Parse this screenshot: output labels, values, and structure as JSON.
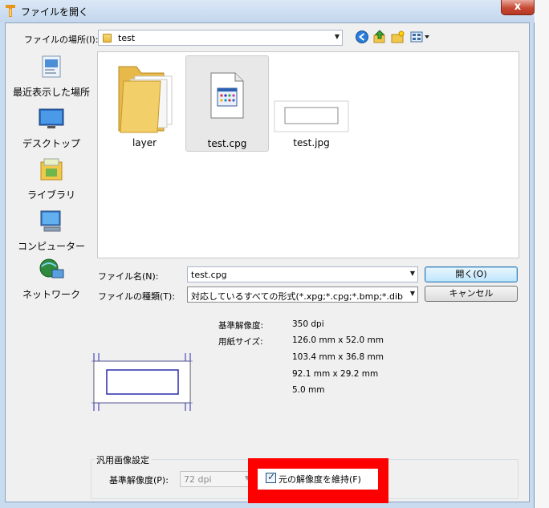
{
  "window": {
    "title": "ファイルを開く",
    "close_label": "x"
  },
  "location": {
    "label": "ファイルの場所(I):",
    "value": "test"
  },
  "places": [
    {
      "label": "最近表示した場所",
      "icon": "recent-places-icon"
    },
    {
      "label": "デスクトップ",
      "icon": "desktop-icon"
    },
    {
      "label": "ライブラリ",
      "icon": "libraries-icon"
    },
    {
      "label": "コンピューター",
      "icon": "computer-icon"
    },
    {
      "label": "ネットワーク",
      "icon": "network-icon"
    }
  ],
  "files": [
    {
      "name": "layer",
      "type": "folder"
    },
    {
      "name": "test.cpg",
      "type": "cpg",
      "selected": true
    },
    {
      "name": "test.jpg",
      "type": "jpg"
    }
  ],
  "filename": {
    "label": "ファイル名(N):",
    "value": "test.cpg"
  },
  "filetype": {
    "label": "ファイルの種類(T):",
    "value": "対応しているすべての形式(*.xpg;*.cpg;*.bmp;*.dib;*.jpg"
  },
  "buttons": {
    "open": "開く(O)",
    "cancel": "キャンセル"
  },
  "info": {
    "resolution_label": "基準解像度:",
    "resolution_value": "350 dpi",
    "paper_label": "用紙サイズ:",
    "paper_values": [
      "126.0 mm x 52.0 mm",
      "103.4 mm x 36.8 mm",
      "92.1 mm x 29.2 mm",
      "5.0 mm"
    ]
  },
  "general": {
    "title": "汎用画像設定",
    "resolution_label": "基準解像度(P):",
    "resolution_value": "72 dpi",
    "keep_label": "元の解像度を維持(F)",
    "keep_checked": true
  },
  "colors": {
    "highlight": "#ff0000",
    "title_bar": "#c4d7ee",
    "default_button": "#bee6fd"
  }
}
